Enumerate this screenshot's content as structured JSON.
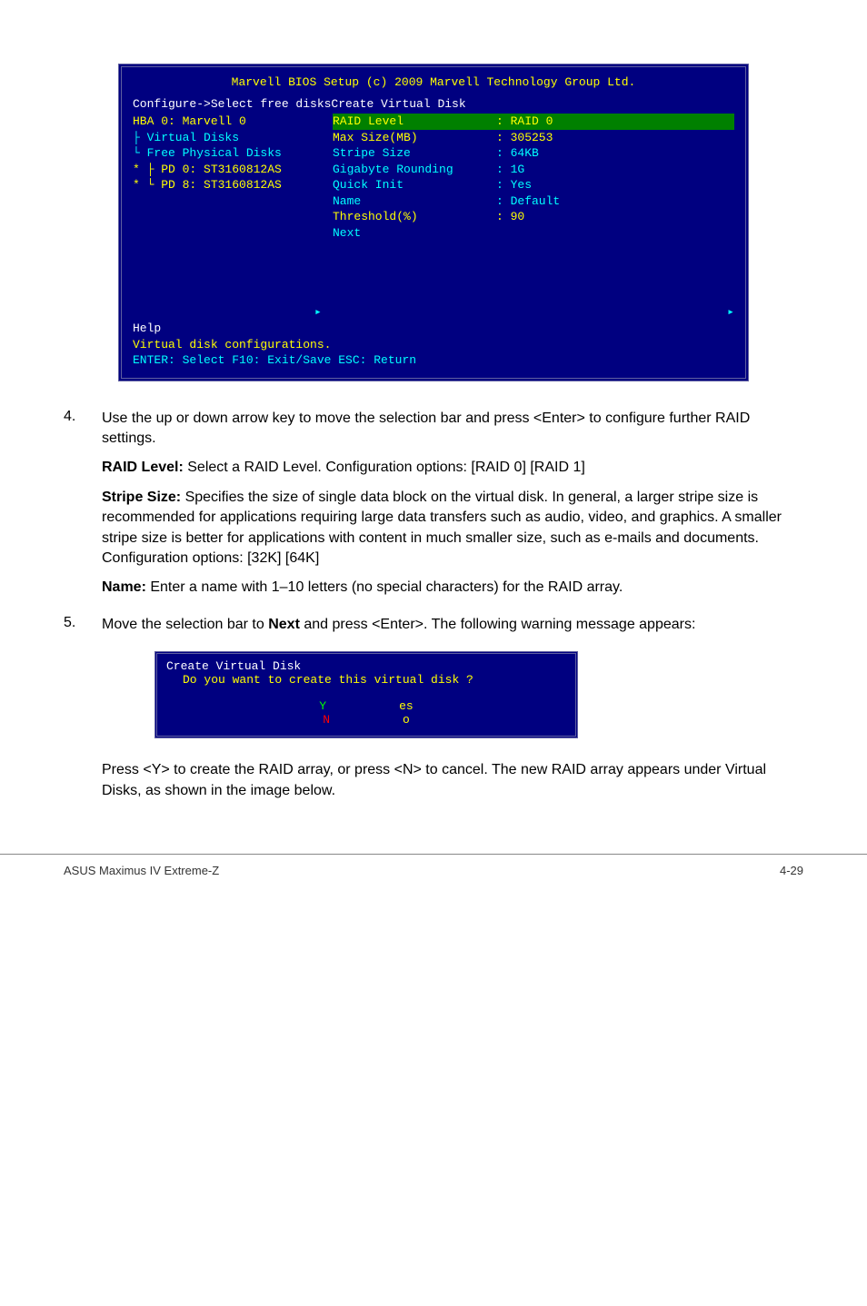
{
  "bios": {
    "title": "Marvell BIOS Setup (c) 2009 Marvell Technology Group Ltd.",
    "subtitle": "Configure->Select free disksCreate Virtual Disk",
    "left": {
      "hba": "HBA 0: Marvell 0",
      "vdisk": "├ Virtual Disks",
      "free": "└ Free Physical Disks",
      "pd0": "*  ├ PD 0: ST3160812AS",
      "pd8": "*  └ PD 8: ST3160812AS",
      "arrow": "▸"
    },
    "right": [
      {
        "k": "RAID Level",
        "v": ": RAID 0",
        "sel": true
      },
      {
        "k": "Max Size(MB)",
        "v": ": 305253",
        "sel": false,
        "yellow": true
      },
      {
        "k": "Stripe Size",
        "v": ": 64KB",
        "sel": false,
        "cyan": true
      },
      {
        "k": "Gigabyte Rounding",
        "v": ": 1G",
        "sel": false,
        "cyan": true
      },
      {
        "k": "Quick Init",
        "v": ": Yes",
        "sel": false,
        "cyan": true
      },
      {
        "k": "Name",
        "v": ": Default",
        "sel": false,
        "cyan": true
      },
      {
        "k": "Threshold(%)",
        "v": ": 90",
        "sel": false,
        "yellow": true
      },
      {
        "k": "Next",
        "v": "",
        "sel": false,
        "cyan": true
      }
    ],
    "arrow_right": "▸",
    "help_label": "Help",
    "help_line": "Virtual disk configurations.",
    "help_keys": "ENTER: Select  F10: Exit/Save  ESC: Return"
  },
  "step4": {
    "num": "4.",
    "p1": "Use the up or down arrow key to move the selection bar and press <Enter> to configure further RAID settings.",
    "raid_label": "RAID Level: ",
    "raid_text": "Select a RAID Level. Configuration options: [RAID 0] [RAID 1]",
    "stripe_label": "Stripe Size: ",
    "stripe_text": "Specifies the size of single data block on the virtual disk. In general, a larger stripe size is recommended for applications requiring large data transfers such as audio, video, and graphics. A smaller stripe size is better for applications with content in much smaller size, such as e-mails and documents.",
    "stripe_cfg": "Configuration options: [32K] [64K]",
    "name_label": "Name: ",
    "name_text": "Enter a name with 1–10 letters (no special characters) for the RAID array."
  },
  "step5": {
    "num": "5.",
    "p_before": "Move the selection bar to ",
    "next_bold": "Next",
    "p_after": " and press <Enter>. The following warning message appears:"
  },
  "dialog": {
    "title": "Create Virtual Disk",
    "question": "Do you want to create this virtual disk ?",
    "yes_letter": "Y",
    "yes_rest": "es",
    "no_letter": "N",
    "no_rest": "o"
  },
  "after_dialog": "Press <Y> to create the RAID array, or press <N> to cancel. The new RAID array appears under Virtual Disks, as shown in the image below.",
  "footer": {
    "left": "ASUS Maximus IV Extreme-Z",
    "right": "4-29"
  }
}
